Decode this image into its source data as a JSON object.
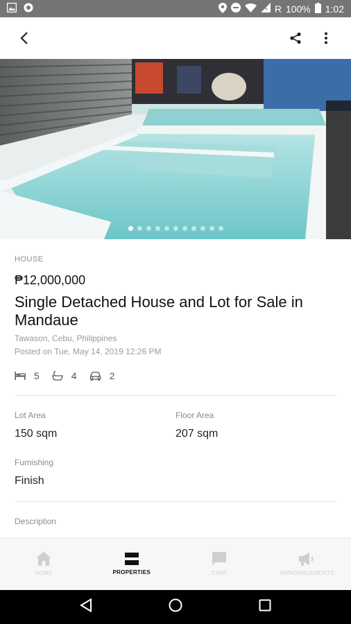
{
  "status_bar": {
    "network": "R",
    "battery": "100%",
    "time": "1:02"
  },
  "hero": {
    "slide_count": 11,
    "active_slide": 1
  },
  "listing": {
    "type": "HOUSE",
    "price": "₱12,000,000",
    "title": "Single Detached House and Lot for Sale in Mandaue",
    "location": "Tawason, Cebu, Philippines",
    "posted": "Posted on Tue, May 14, 2019 12:26 PM",
    "bedrooms": "5",
    "bathrooms": "4",
    "parking": "2",
    "lot_area_label": "Lot Area",
    "lot_area": "150 sqm",
    "floor_area_label": "Floor Area",
    "floor_area": "207 sqm",
    "furnishing_label": "Furnishing",
    "furnishing": "Finish",
    "description_label": "Description"
  },
  "bottom_nav": {
    "items": [
      {
        "label": "HOME",
        "icon": "home-icon",
        "active": false
      },
      {
        "label": "PROPERTIES",
        "icon": "properties-icon",
        "active": true
      },
      {
        "label": "CHAT",
        "icon": "chat-icon",
        "active": false
      },
      {
        "label": "ANNOUNCEMENTS",
        "icon": "megaphone-icon",
        "active": false
      }
    ]
  },
  "colors": {
    "status_bar": "#757575",
    "inactive_nav": "#cfcfcf",
    "active_nav": "#111111"
  }
}
